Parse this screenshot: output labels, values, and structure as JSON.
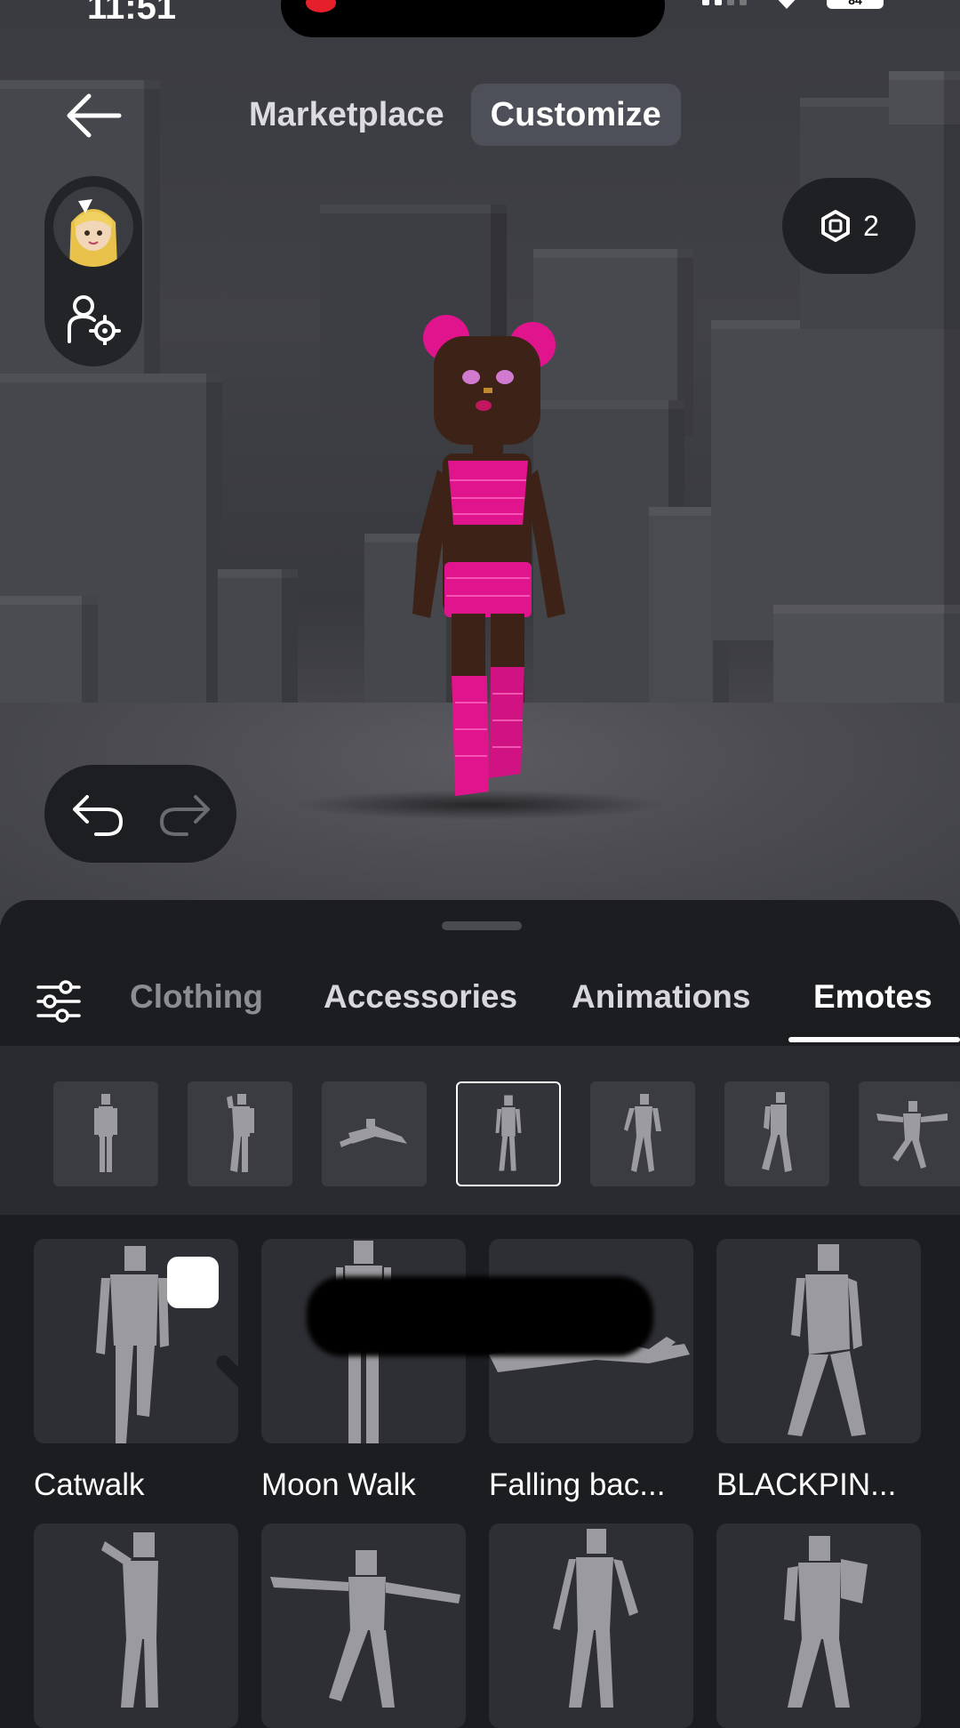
{
  "status_bar": {
    "time": "11:51",
    "battery": "84"
  },
  "top_nav": {
    "back_icon": "arrow-left-icon",
    "tabs": [
      {
        "label": "Marketplace",
        "active": false
      },
      {
        "label": "Customize",
        "active": true
      }
    ]
  },
  "side_controls": {
    "avatar_icon": "avatar-thumbnail",
    "settings_icon": "avatar-settings-icon"
  },
  "currency": {
    "icon": "robux-icon",
    "amount": "2"
  },
  "history": {
    "undo_icon": "undo-icon",
    "redo_icon": "redo-icon"
  },
  "category_tabs": [
    {
      "label": "Clothing",
      "active": false
    },
    {
      "label": "Accessories",
      "active": false
    },
    {
      "label": "Animations",
      "active": false
    },
    {
      "label": "Emotes",
      "active": true
    }
  ],
  "sub_filter_icons": [
    "figure-standing-icon",
    "figure-pose-icon",
    "figure-lying-icon",
    "figure-walking-icon",
    "figure-dancing-icon",
    "figure-running-icon",
    "figure-jumping-icon"
  ],
  "selected_sub_filter": 3,
  "emotes": [
    {
      "label": "Catwalk",
      "equipped": true
    },
    {
      "label": "Moon Walk",
      "equipped": false
    },
    {
      "label": "Falling bac...",
      "equipped": false
    },
    {
      "label": "BLACKPIN...",
      "equipped": false
    },
    {
      "label": "",
      "equipped": false
    },
    {
      "label": "",
      "equipped": false
    },
    {
      "label": "",
      "equipped": false
    },
    {
      "label": "",
      "equipped": false
    }
  ],
  "colors": {
    "accent_pink": "#e0148c",
    "skin": "#3d2317",
    "sheet_bg": "#1c1d21",
    "tab_active_bg": "#4d5058"
  }
}
